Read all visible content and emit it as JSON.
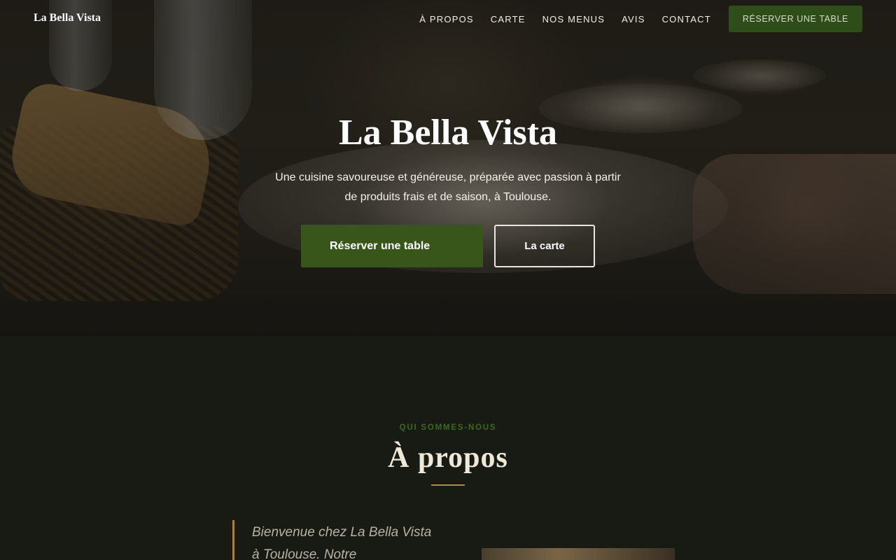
{
  "brand": {
    "name": "La Bella Vista"
  },
  "nav": {
    "links": [
      "À propos",
      "Carte",
      "Nos menus",
      "Avis",
      "Contact"
    ],
    "cta": "Réserver une table"
  },
  "hero": {
    "title": "La Bella Vista",
    "subtitle": "Une cuisine savoureuse et généreuse, préparée avec passion à partir de produits frais et de saison, à Toulouse.",
    "primary_button": "Réserver une table",
    "secondary_button": "La carte"
  },
  "about": {
    "eyebrow": "QUI SOMMES-NOUS",
    "title": "À propos",
    "intro": "Bienvenue chez La Bella Vista à Toulouse. Notre"
  },
  "colors": {
    "accent_green": "#38561a",
    "gold": "#b48a42",
    "background": "#181a14"
  }
}
